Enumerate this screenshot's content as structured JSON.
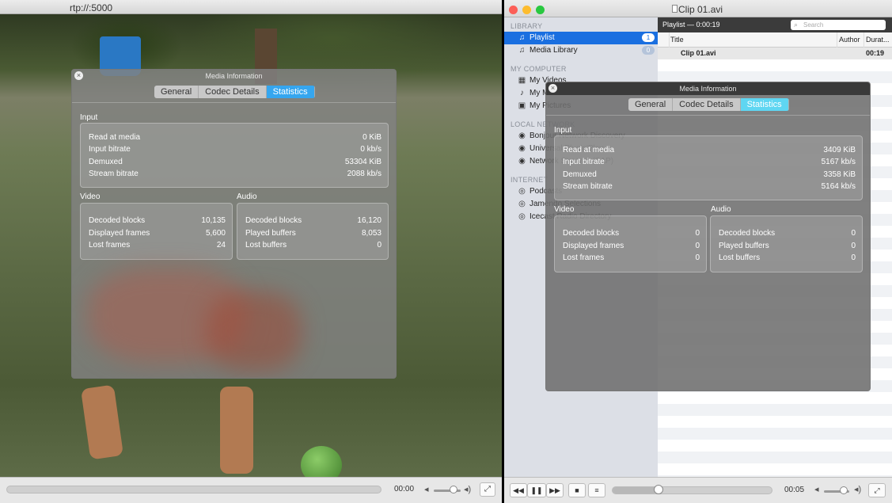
{
  "left_window": {
    "title": "rtp://:5000",
    "time": "00:00"
  },
  "left_info": {
    "title": "Media Information",
    "tabs": [
      "General",
      "Codec Details",
      "Statistics"
    ],
    "active_tab": "Statistics",
    "input_label": "Input",
    "input": [
      {
        "label": "Read at media",
        "value": "0 KiB"
      },
      {
        "label": "Input bitrate",
        "value": "0 kb/s"
      },
      {
        "label": "Demuxed",
        "value": "53304 KiB"
      },
      {
        "label": "Stream bitrate",
        "value": "2088 kb/s"
      }
    ],
    "video_label": "Video",
    "video": [
      {
        "label": "Decoded blocks",
        "value": "10,135"
      },
      {
        "label": "Displayed frames",
        "value": "5,600"
      },
      {
        "label": "Lost frames",
        "value": "24"
      }
    ],
    "audio_label": "Audio",
    "audio": [
      {
        "label": "Decoded blocks",
        "value": "16,120"
      },
      {
        "label": "Played buffers",
        "value": "8,053"
      },
      {
        "label": "Lost buffers",
        "value": "0"
      }
    ]
  },
  "right_window": {
    "title": "Clip 01.avi",
    "sidebar": {
      "library_header": "LIBRARY",
      "library": [
        {
          "label": "Playlist",
          "badge": "1",
          "icon": "music-note-icon"
        },
        {
          "label": "Media Library",
          "badge": "0",
          "icon": "music-note-icon"
        }
      ],
      "computer_header": "MY COMPUTER",
      "computer": [
        {
          "label": "My Videos",
          "icon": "film-icon"
        },
        {
          "label": "My Music",
          "icon": "music-icon"
        },
        {
          "label": "My Pictures",
          "icon": "picture-icon"
        }
      ],
      "network_header": "LOCAL NETWORK",
      "network": [
        {
          "label": "Bonjour Network Discovery",
          "icon": "network-icon"
        },
        {
          "label": "Universal Plug'n'Play",
          "icon": "network-icon"
        },
        {
          "label": "Network Streams (SAP)",
          "icon": "network-icon"
        }
      ],
      "internet_header": "INTERNET",
      "internet": [
        {
          "label": "Podcasts",
          "icon": "broadcast-icon"
        },
        {
          "label": "Jamendo Selections",
          "icon": "broadcast-icon"
        },
        {
          "label": "Icecast Radio Directory",
          "icon": "broadcast-icon"
        }
      ]
    },
    "playlist_header": "Playlist — 0:00:19",
    "search_placeholder": "Search",
    "columns": {
      "title": "Title",
      "author": "Author",
      "duration": "Durat..."
    },
    "rows": [
      {
        "title": "Clip 01.avi",
        "author": "",
        "duration": "00:19"
      }
    ],
    "time": "00:05",
    "progress": 0.28
  },
  "right_info": {
    "title": "Media Information",
    "tabs": [
      "General",
      "Codec Details",
      "Statistics"
    ],
    "active_tab": "Statistics",
    "input_label": "Input",
    "input": [
      {
        "label": "Read at media",
        "value": "3409 KiB"
      },
      {
        "label": "Input bitrate",
        "value": "5167 kb/s"
      },
      {
        "label": "Demuxed",
        "value": "3358 KiB"
      },
      {
        "label": "Stream bitrate",
        "value": "5164 kb/s"
      }
    ],
    "video_label": "Video",
    "video": [
      {
        "label": "Decoded blocks",
        "value": "0"
      },
      {
        "label": "Displayed frames",
        "value": "0"
      },
      {
        "label": "Lost frames",
        "value": "0"
      }
    ],
    "audio_label": "Audio",
    "audio": [
      {
        "label": "Decoded blocks",
        "value": "0"
      },
      {
        "label": "Played buffers",
        "value": "0"
      },
      {
        "label": "Lost buffers",
        "value": "0"
      }
    ]
  },
  "colors": {
    "accent_blue": "#1a6fe0",
    "active_tab": "#35a6ef"
  }
}
